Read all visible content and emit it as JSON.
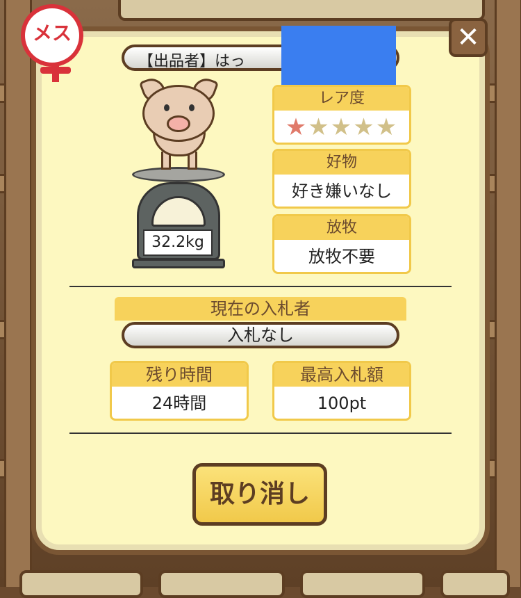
{
  "seller": {
    "label": "【出品者】はっ"
  },
  "sex_badge": {
    "label": "メス"
  },
  "rarity": {
    "label": "レア度",
    "stars_filled": 1,
    "stars_total": 5
  },
  "favorite": {
    "label": "好物",
    "value": "好き嫌いなし"
  },
  "grazing": {
    "label": "放牧",
    "value": "放牧不要"
  },
  "weight": "32.2kg",
  "current_bidder": {
    "label": "現在の入札者",
    "value": "入札なし"
  },
  "time_left": {
    "label": "残り時間",
    "value": "24時間"
  },
  "highest_bid": {
    "label": "最高入札額",
    "value": "100pt"
  },
  "cancel_button": "取り消し",
  "close_icon": "close-icon",
  "colors": {
    "panel": "#fdf8c0",
    "header": "#f7d25b",
    "border": "#5c3d22",
    "accent_red": "#d9323a",
    "star_filled": "#e07a6a",
    "star_empty": "#d1c089"
  }
}
